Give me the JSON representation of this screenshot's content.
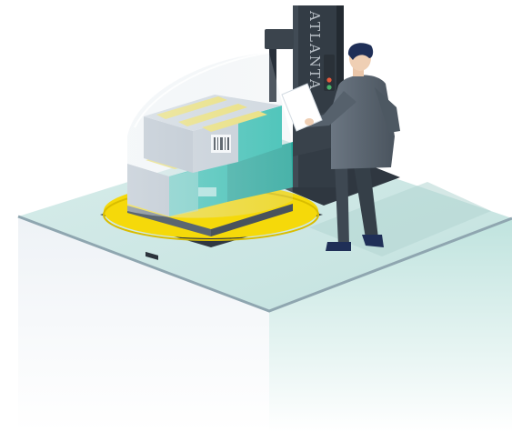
{
  "machine": {
    "brand_text": "ATLANTA"
  },
  "colors": {
    "platform_top": "#cfe8e6",
    "platform_side_light": "#f2f6f8",
    "platform_side_teal": "#bfe3de",
    "platform_edge": "#8fa6b0",
    "turntable_yellow": "#f5d90a",
    "turntable_base": "#2f3740",
    "tower_dark": "#333c45",
    "box_teal": "#2ebfb0",
    "box_gray": "#b9c2cc",
    "tape_yellow": "#f1e26a",
    "stretch_film": "#dfe8ee",
    "worker_jacket": "#56616c",
    "worker_hair": "#1f2f57",
    "status_light_red": "#e65a3c",
    "status_light_green": "#49b36a"
  }
}
